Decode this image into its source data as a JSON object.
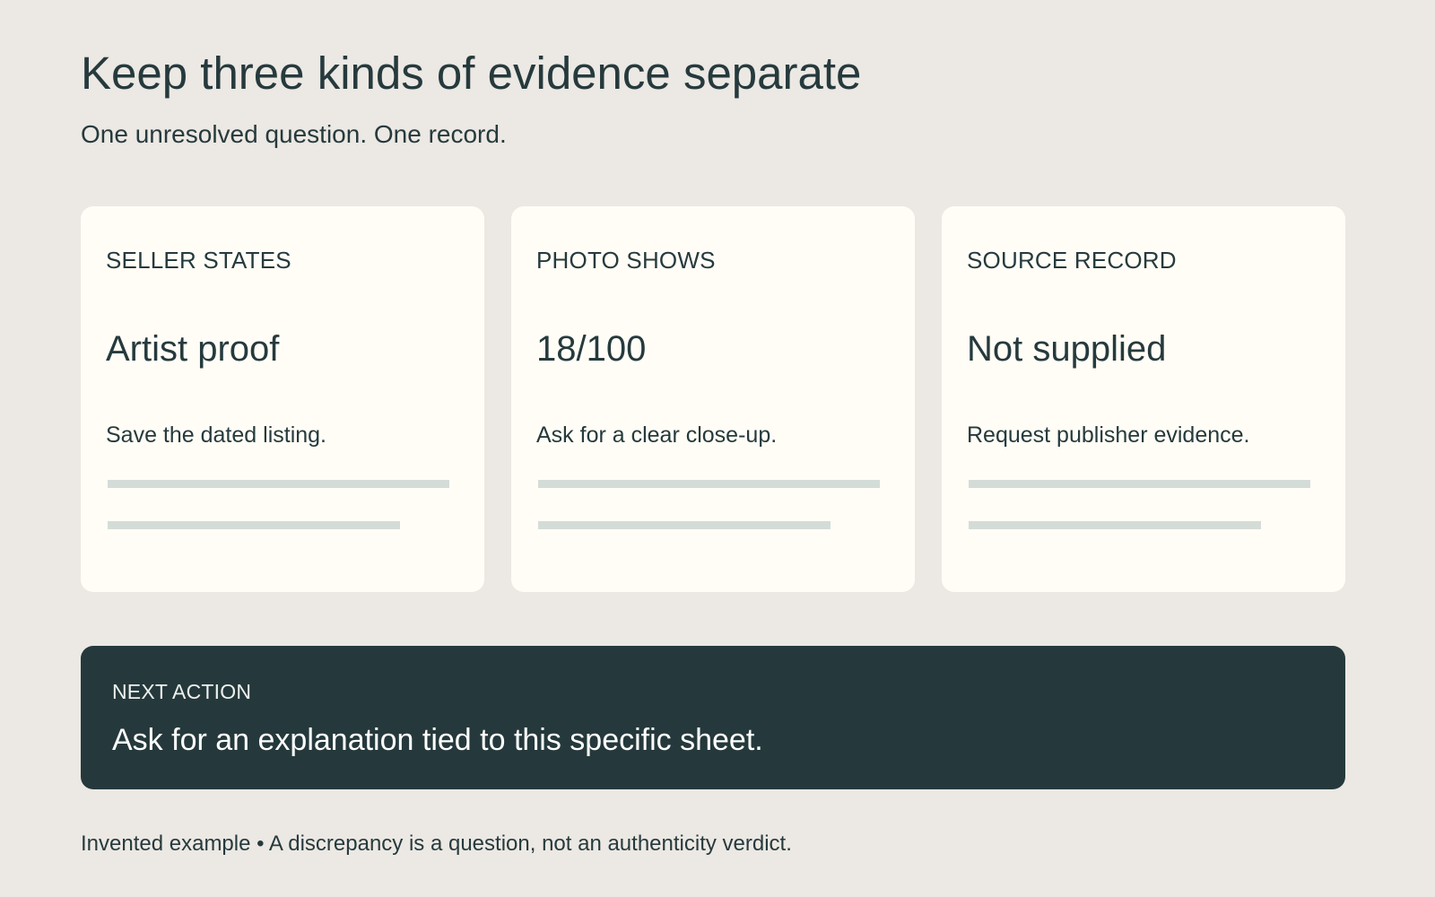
{
  "header": {
    "title": "Keep three kinds of evidence separate",
    "subtitle": "One unresolved question. One record."
  },
  "cards": [
    {
      "label": "SELLER STATES",
      "value": "Artist proof",
      "note": "Save the dated listing."
    },
    {
      "label": "PHOTO SHOWS",
      "value": "18/100",
      "note": "Ask for a clear close-up."
    },
    {
      "label": "SOURCE RECORD",
      "value": "Not supplied",
      "note": "Request publisher evidence."
    }
  ],
  "next_action": {
    "label": "NEXT ACTION",
    "text": "Ask for an explanation tied to this specific sheet."
  },
  "footer": {
    "label": "Invented example",
    "separator": " • ",
    "text": "A discrepancy is a question, not an authenticity verdict."
  },
  "colors": {
    "background": "#ece8e3",
    "card_background": "#fffdf6",
    "text": "#263a3d",
    "accent_panel": "#25393c",
    "placeholder": "#d4dcd8"
  }
}
